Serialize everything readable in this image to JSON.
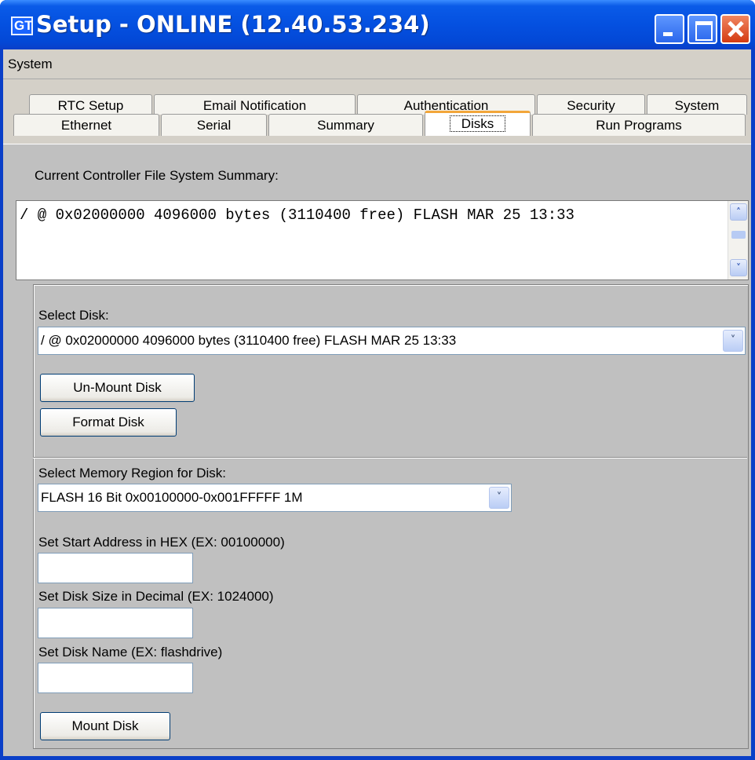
{
  "window": {
    "title": "Setup - ONLINE (12.40.53.234)",
    "icon_text": "GT"
  },
  "menu": {
    "items": [
      "System"
    ]
  },
  "tabs": {
    "row1": [
      "RTC Setup",
      "Email Notification",
      "Authentication",
      "Security",
      "System"
    ],
    "row2": [
      "Ethernet",
      "Serial",
      "Summary",
      "Disks",
      "Run Programs"
    ],
    "active": "Disks"
  },
  "summary": {
    "label": "Current Controller File System Summary:",
    "line": "/ @ 0x02000000 4096000 bytes (3110400 free) FLASH MAR 25 13:33"
  },
  "disk": {
    "select_label": "Select Disk:",
    "selected": "/ @ 0x02000000 4096000 bytes (3110400 free) FLASH MAR 25 13:33",
    "unmount_label": "Un-Mount Disk",
    "format_label": "Format Disk"
  },
  "mount": {
    "region_label": "Select Memory Region for Disk:",
    "region_selected": "FLASH 16 Bit 0x00100000-0x001FFFFF 1M",
    "start_label": "Set Start Address in HEX (EX: 00100000)",
    "start_value": "",
    "size_label": "Set Disk Size in Decimal (EX: 1024000)",
    "size_value": "",
    "name_label": "Set Disk Name (EX: flashdrive)",
    "name_value": "",
    "mount_label": "Mount Disk"
  },
  "icons": {
    "scroll_up": "chevron-up-icon",
    "scroll_down": "chevron-down-icon",
    "dropdown": "chevron-down-icon"
  }
}
